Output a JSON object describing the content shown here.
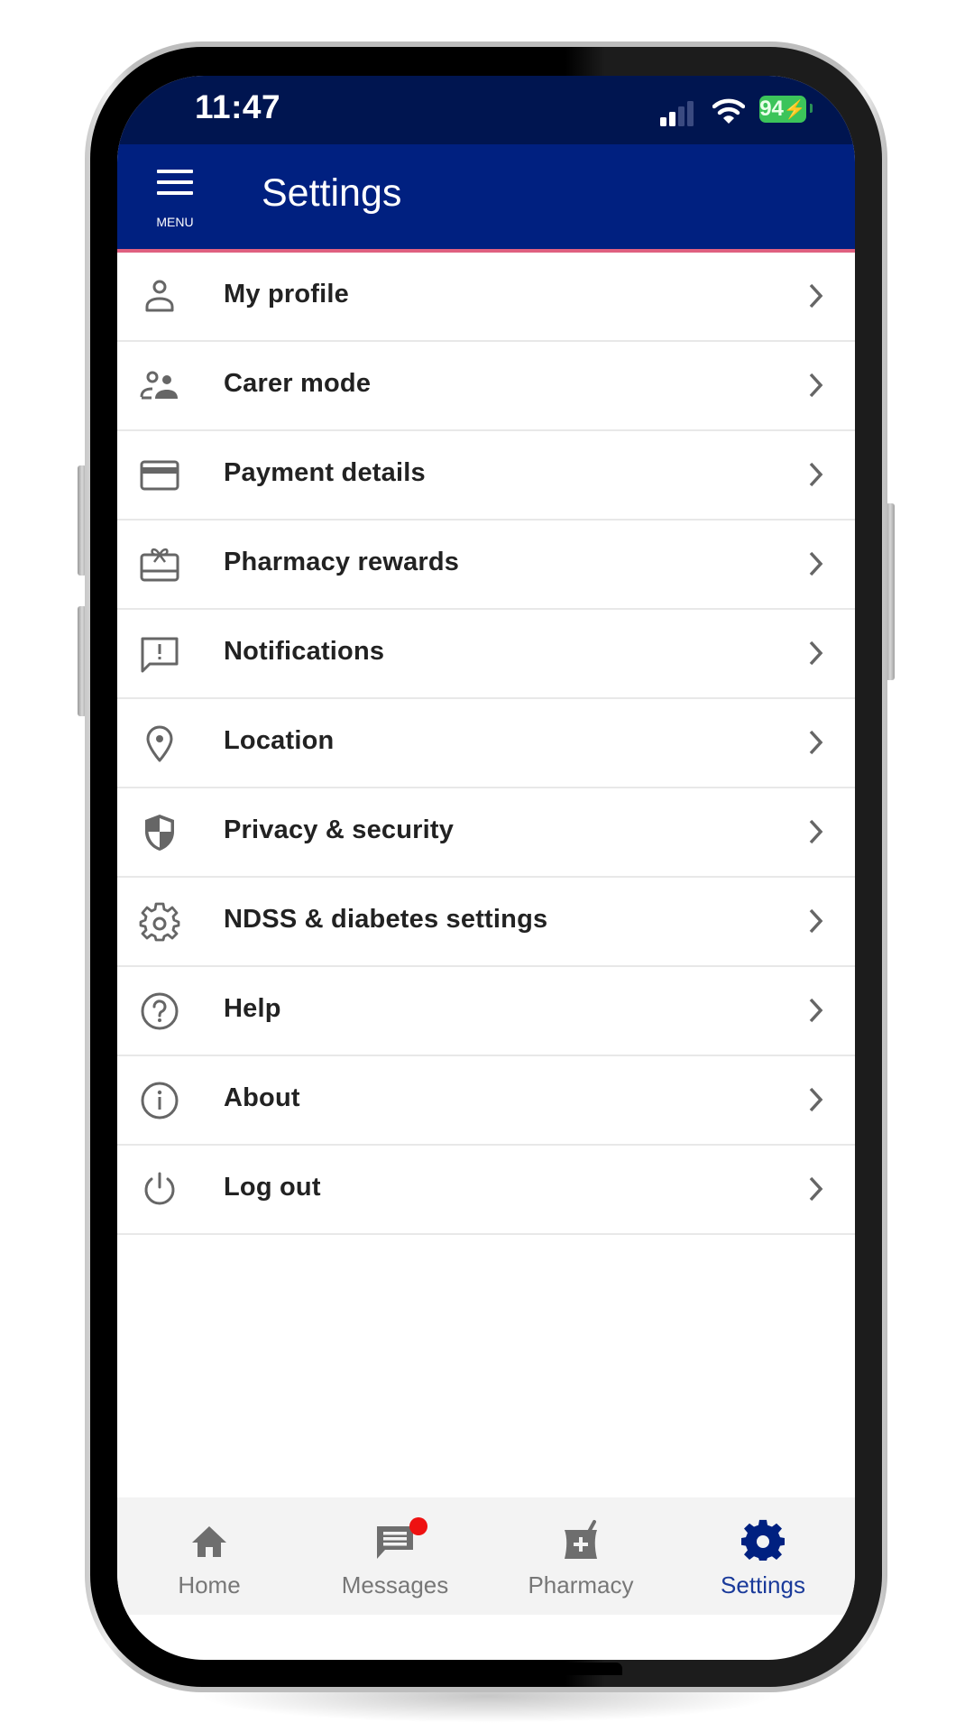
{
  "status_bar": {
    "time": "11:47",
    "battery_percent": "94",
    "charging": true,
    "signal_bars_active": 2,
    "signal_bars_total": 4,
    "wifi": "wifi-icon"
  },
  "app_bar": {
    "menu_label": "MENU",
    "title": "Settings",
    "background_color": "#002080",
    "accent_line_color": "#e06080"
  },
  "settings_list": [
    {
      "label": "My profile",
      "icon": "person-icon"
    },
    {
      "label": "Carer mode",
      "icon": "people-icon"
    },
    {
      "label": "Payment details",
      "icon": "credit-card-icon"
    },
    {
      "label": "Pharmacy rewards",
      "icon": "gift-card-icon"
    },
    {
      "label": "Notifications",
      "icon": "alert-message-icon"
    },
    {
      "label": "Location",
      "icon": "location-pin-icon"
    },
    {
      "label": "Privacy & security",
      "icon": "shield-icon"
    },
    {
      "label": "NDSS & diabetes settings",
      "icon": "gear-icon"
    },
    {
      "label": "Help",
      "icon": "help-circle-icon"
    },
    {
      "label": "About",
      "icon": "info-circle-icon"
    },
    {
      "label": "Log out",
      "icon": "power-icon"
    }
  ],
  "bottom_nav": {
    "active": "Settings",
    "active_color": "#002080",
    "inactive_color": "#777777",
    "tabs": [
      {
        "label": "Home",
        "icon": "home-icon"
      },
      {
        "label": "Messages",
        "icon": "messages-icon",
        "has_unread_badge": true
      },
      {
        "label": "Pharmacy",
        "icon": "mortar-pestle-icon"
      },
      {
        "label": "Settings",
        "icon": "gear-icon"
      }
    ]
  }
}
